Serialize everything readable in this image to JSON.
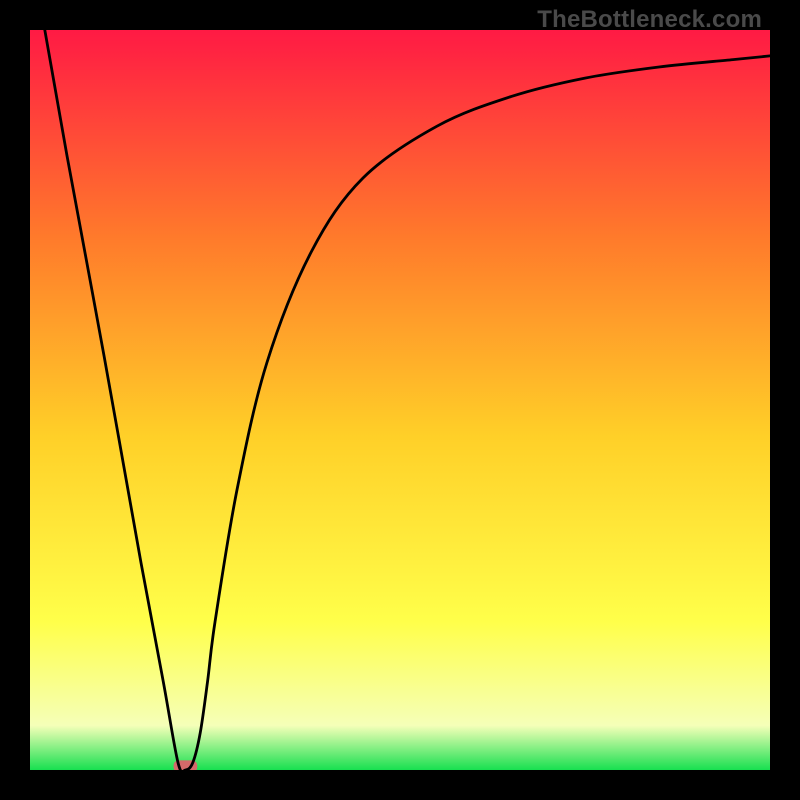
{
  "watermark": "TheBottleneck.com",
  "chart_data": {
    "type": "line",
    "title": "",
    "xlabel": "",
    "ylabel": "",
    "xlim": [
      0,
      100
    ],
    "ylim": [
      0,
      100
    ],
    "grid": false,
    "legend": false,
    "background_gradient": {
      "top_color": "#ff1a44",
      "mid_top_color": "#ff7a2b",
      "mid_color": "#ffd028",
      "mid_bottom_color": "#ffff4a",
      "near_bottom_color": "#f5ffb8",
      "bottom_color": "#18e050"
    },
    "series": [
      {
        "name": "bottleneck-curve",
        "color": "#000000",
        "x": [
          2,
          5,
          10,
          15,
          18,
          20,
          21,
          22,
          23,
          24,
          25,
          28,
          32,
          38,
          45,
          55,
          65,
          75,
          85,
          95,
          100
        ],
        "y": [
          100,
          83,
          56,
          28,
          12,
          1,
          0,
          1,
          5,
          12,
          20,
          38,
          55,
          70,
          80,
          87,
          91,
          93.5,
          95,
          96,
          96.5
        ]
      }
    ],
    "markers": [
      {
        "name": "min-marker",
        "shape": "rounded-rect",
        "x": 21,
        "y": 0.5,
        "width": 3.2,
        "height": 1.6,
        "color": "#d46a6a"
      }
    ]
  }
}
